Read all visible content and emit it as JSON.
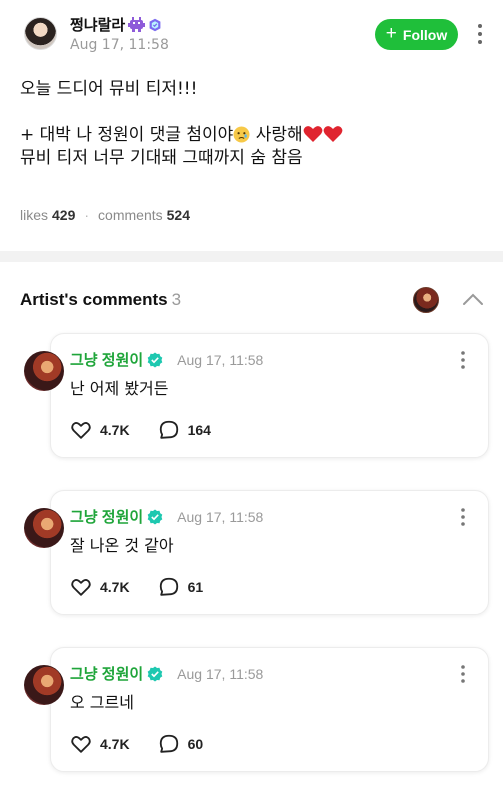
{
  "post": {
    "author": "쩡냐랄라",
    "time": "Aug 17, 11:58",
    "follow_label": "Follow",
    "body": {
      "line1": "오늘 드디어 뮤비 티저!!!",
      "line2": "+ 대박 나 정원이 댓글 첨이야",
      "line2_tail": " 사랑해",
      "line3": "뮤비 티저 너무 기대돼 그때까지 숨 참음"
    },
    "stats": {
      "likes_label": "likes",
      "likes": "429",
      "comments_label": "comments",
      "comments": "524"
    },
    "icons": [
      "alien-emoji-icon",
      "verified-fan-badge-icon",
      "more-vertical-icon",
      "crying-face-emoji-icon",
      "red-heart-emoji-icon"
    ]
  },
  "artist_comments": {
    "title": "Artist's comments",
    "count": "3",
    "items": [
      {
        "author": "그냥 정원이",
        "time": "Aug 17, 11:58",
        "text": "난 어제 봤거든",
        "likes": "4.7K",
        "replies": "164"
      },
      {
        "author": "그냥 정원이",
        "time": "Aug 17, 11:58",
        "text": "잘 나온 것 같아",
        "likes": "4.7K",
        "replies": "61"
      },
      {
        "author": "그냥 정원이",
        "time": "Aug 17, 11:58",
        "text": "오 그르네",
        "likes": "4.7K",
        "replies": "60"
      }
    ]
  },
  "colors": {
    "brand_green": "#1fbf3a",
    "artist_name_green": "#1fa53a",
    "verified_teal": "#1ec8b0",
    "muted_text": "#9a9a9a",
    "heart_red": "#e0242f"
  }
}
